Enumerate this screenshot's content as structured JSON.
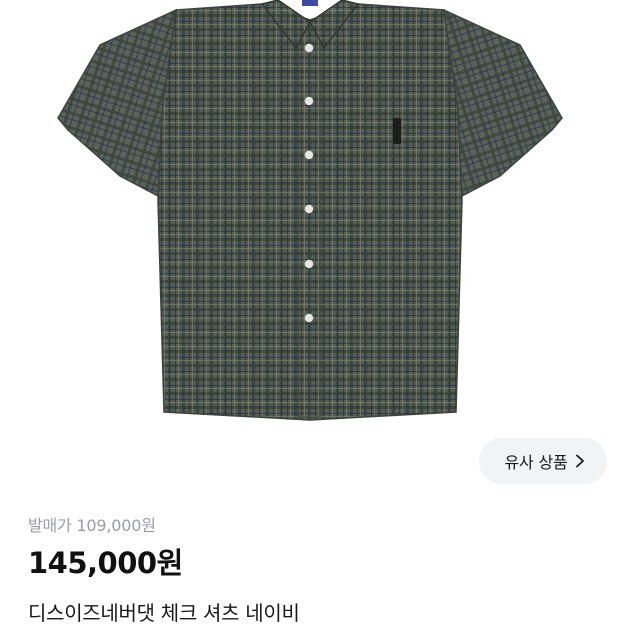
{
  "product": {
    "image_alt": "checked short-sleeve shirt product photo",
    "similar_button_label": "유사 상품",
    "release_price": "발매가 109,000원",
    "current_price": "145,000원",
    "title": "디스이즈네버댓 체크 셔츠 네이비"
  },
  "colors": {
    "shirt_base": "#5b6258",
    "check_line_dark": "#2e3531",
    "check_line_navy": "#2d3950",
    "check_line_light": "#8a8f82",
    "button_fill": "#f2f3f5",
    "muted_text": "#9b9da3"
  },
  "icons": {
    "similar_button_icon": "chevron-right-icon"
  }
}
